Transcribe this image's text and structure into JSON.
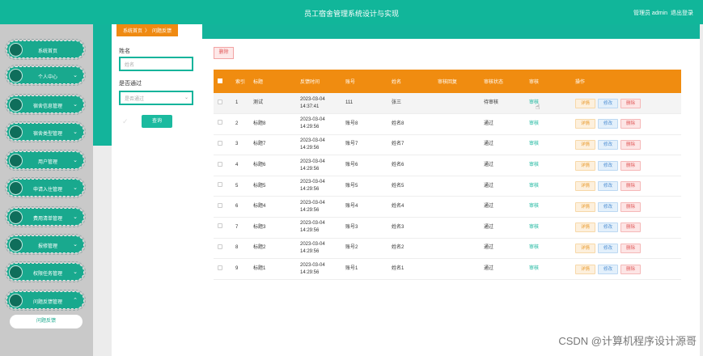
{
  "header": {
    "title": "员工宿舍管理系统设计与实现",
    "user": "管理员 admin",
    "logout": "退出登录"
  },
  "sidebar": {
    "items": [
      {
        "label": "系统首页",
        "chevron": ""
      },
      {
        "label": "个人中心",
        "chevron": "⌄"
      },
      {
        "label": "宿舍信息管理",
        "chevron": "⌄"
      },
      {
        "label": "宿舍类型管理",
        "chevron": "⌄"
      },
      {
        "label": "用户管理",
        "chevron": "⌄"
      },
      {
        "label": "申请入住管理",
        "chevron": "⌄"
      },
      {
        "label": "费用清单管理",
        "chevron": "⌄"
      },
      {
        "label": "报修管理",
        "chevron": "⌄"
      },
      {
        "label": "权限任务管理",
        "chevron": "⌄"
      },
      {
        "label": "问题反馈管理",
        "chevron": "⌃"
      }
    ],
    "submenu_label": "问题反馈"
  },
  "breadcrumb": {
    "home": "系统首页",
    "sep": "〉",
    "current": "问题反馈"
  },
  "search": {
    "name_label": "姓名",
    "name_placeholder": "姓名",
    "passed_label": "是否通过",
    "passed_placeholder": "是否通过",
    "query_label": "查询"
  },
  "toolbar": {
    "delete_label": "删除"
  },
  "table": {
    "headers": [
      "",
      "索引",
      "标题",
      "反馈时间",
      "账号",
      "姓名",
      "审核回复",
      "审核状态",
      "审核",
      "操作"
    ],
    "action_labels": {
      "detail": "详情",
      "edit": "修改",
      "delete": "删除"
    },
    "rows": [
      {
        "index": "1",
        "title": "测试",
        "time": "2023-03-04 14:37:41",
        "account": "111",
        "name": "张三",
        "reply": "",
        "status": "待审核",
        "audit": "审核"
      },
      {
        "index": "2",
        "title": "标题8",
        "time": "2023-03-04 14:29:56",
        "account": "账号8",
        "name": "姓名8",
        "reply": "",
        "status": "通过",
        "audit": "审核"
      },
      {
        "index": "3",
        "title": "标题7",
        "time": "2023-03-04 14:29:56",
        "account": "账号7",
        "name": "姓名7",
        "reply": "",
        "status": "通过",
        "audit": "审核"
      },
      {
        "index": "4",
        "title": "标题6",
        "time": "2023-03-04 14:29:56",
        "account": "账号6",
        "name": "姓名6",
        "reply": "",
        "status": "通过",
        "audit": "审核"
      },
      {
        "index": "5",
        "title": "标题5",
        "time": "2023-03-04 14:29:56",
        "account": "账号5",
        "name": "姓名5",
        "reply": "",
        "status": "通过",
        "audit": "审核"
      },
      {
        "index": "6",
        "title": "标题4",
        "time": "2023-03-04 14:29:56",
        "account": "账号4",
        "name": "姓名4",
        "reply": "",
        "status": "通过",
        "audit": "审核"
      },
      {
        "index": "7",
        "title": "标题3",
        "time": "2023-03-04 14:29:56",
        "account": "账号3",
        "name": "姓名3",
        "reply": "",
        "status": "通过",
        "audit": "审核"
      },
      {
        "index": "8",
        "title": "标题2",
        "time": "2023-03-04 14:29:56",
        "account": "账号2",
        "name": "姓名2",
        "reply": "",
        "status": "通过",
        "audit": "审核"
      },
      {
        "index": "9",
        "title": "标题1",
        "time": "2023-03-04 14:29:56",
        "account": "账号1",
        "name": "姓名1",
        "reply": "",
        "status": "通过",
        "audit": "审核"
      }
    ]
  },
  "watermark": "CSDN @计算机程序设计源哥",
  "colors": {
    "primary": "#13b49b",
    "accent": "#f08c10"
  }
}
